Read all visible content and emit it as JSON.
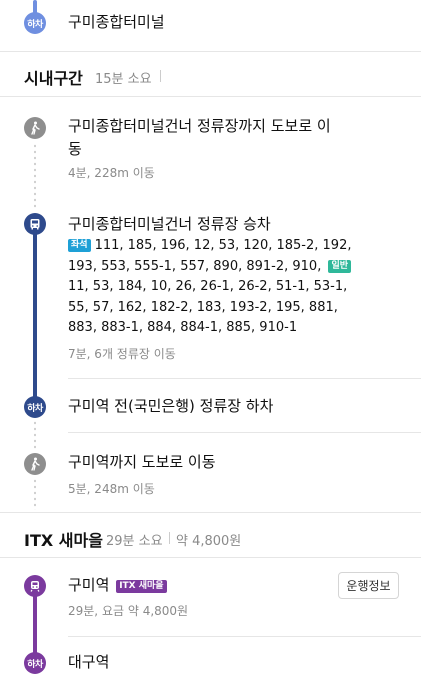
{
  "top": {
    "badge": "하차",
    "stop_name": "구미종합터미널"
  },
  "section_city": {
    "title": "시내구간",
    "duration": "15분 소요"
  },
  "walk1": {
    "title_line1": "구미종합터미널건너 정류장까지 도보로 이",
    "title_line2": "동",
    "sub": "4분, 228m 이동"
  },
  "bus": {
    "title": "구미종합터미널건너 정류장 승차",
    "badge_express": "좌석",
    "express_routes": "111, 185, 196, 12, 53, 120, 185-2, 192, 193, 553, 555-1, 557, 890, 891-2, 910,",
    "badge_general": "일반",
    "general_routes": "11, 53, 184, 10, 26, 26-1, 26-2, 51-1, 53-1, 55, 57, 162, 182-2, 183, 193-2, 195, 881, 883, 883-1, 884, 884-1, 885, 910-1",
    "sub": "7분, 6개 정류장 이동"
  },
  "alight": {
    "badge": "하차",
    "title": "구미역 전(국민은행) 정류장 하차"
  },
  "walk2": {
    "title": "구미역까지 도보로 이동",
    "sub": "5분, 248m 이동"
  },
  "section_itx": {
    "title": "ITX 새마을",
    "duration": "29분 소요",
    "fare": "약 4,800원"
  },
  "train": {
    "station": "구미역",
    "badge": "ITX 새마을",
    "sub": "29분, 요금 약 4,800원",
    "info_button": "운행정보"
  },
  "dest": {
    "badge": "하차",
    "station": "대구역"
  },
  "colors": {
    "bus_line": "#2e4a8c",
    "train_line": "#7b3a9e",
    "top_line": "#6f8fe0",
    "walk_node": "#8e8e8e",
    "express_badge": "#1ea0d6",
    "general_badge": "#2fb89a"
  }
}
